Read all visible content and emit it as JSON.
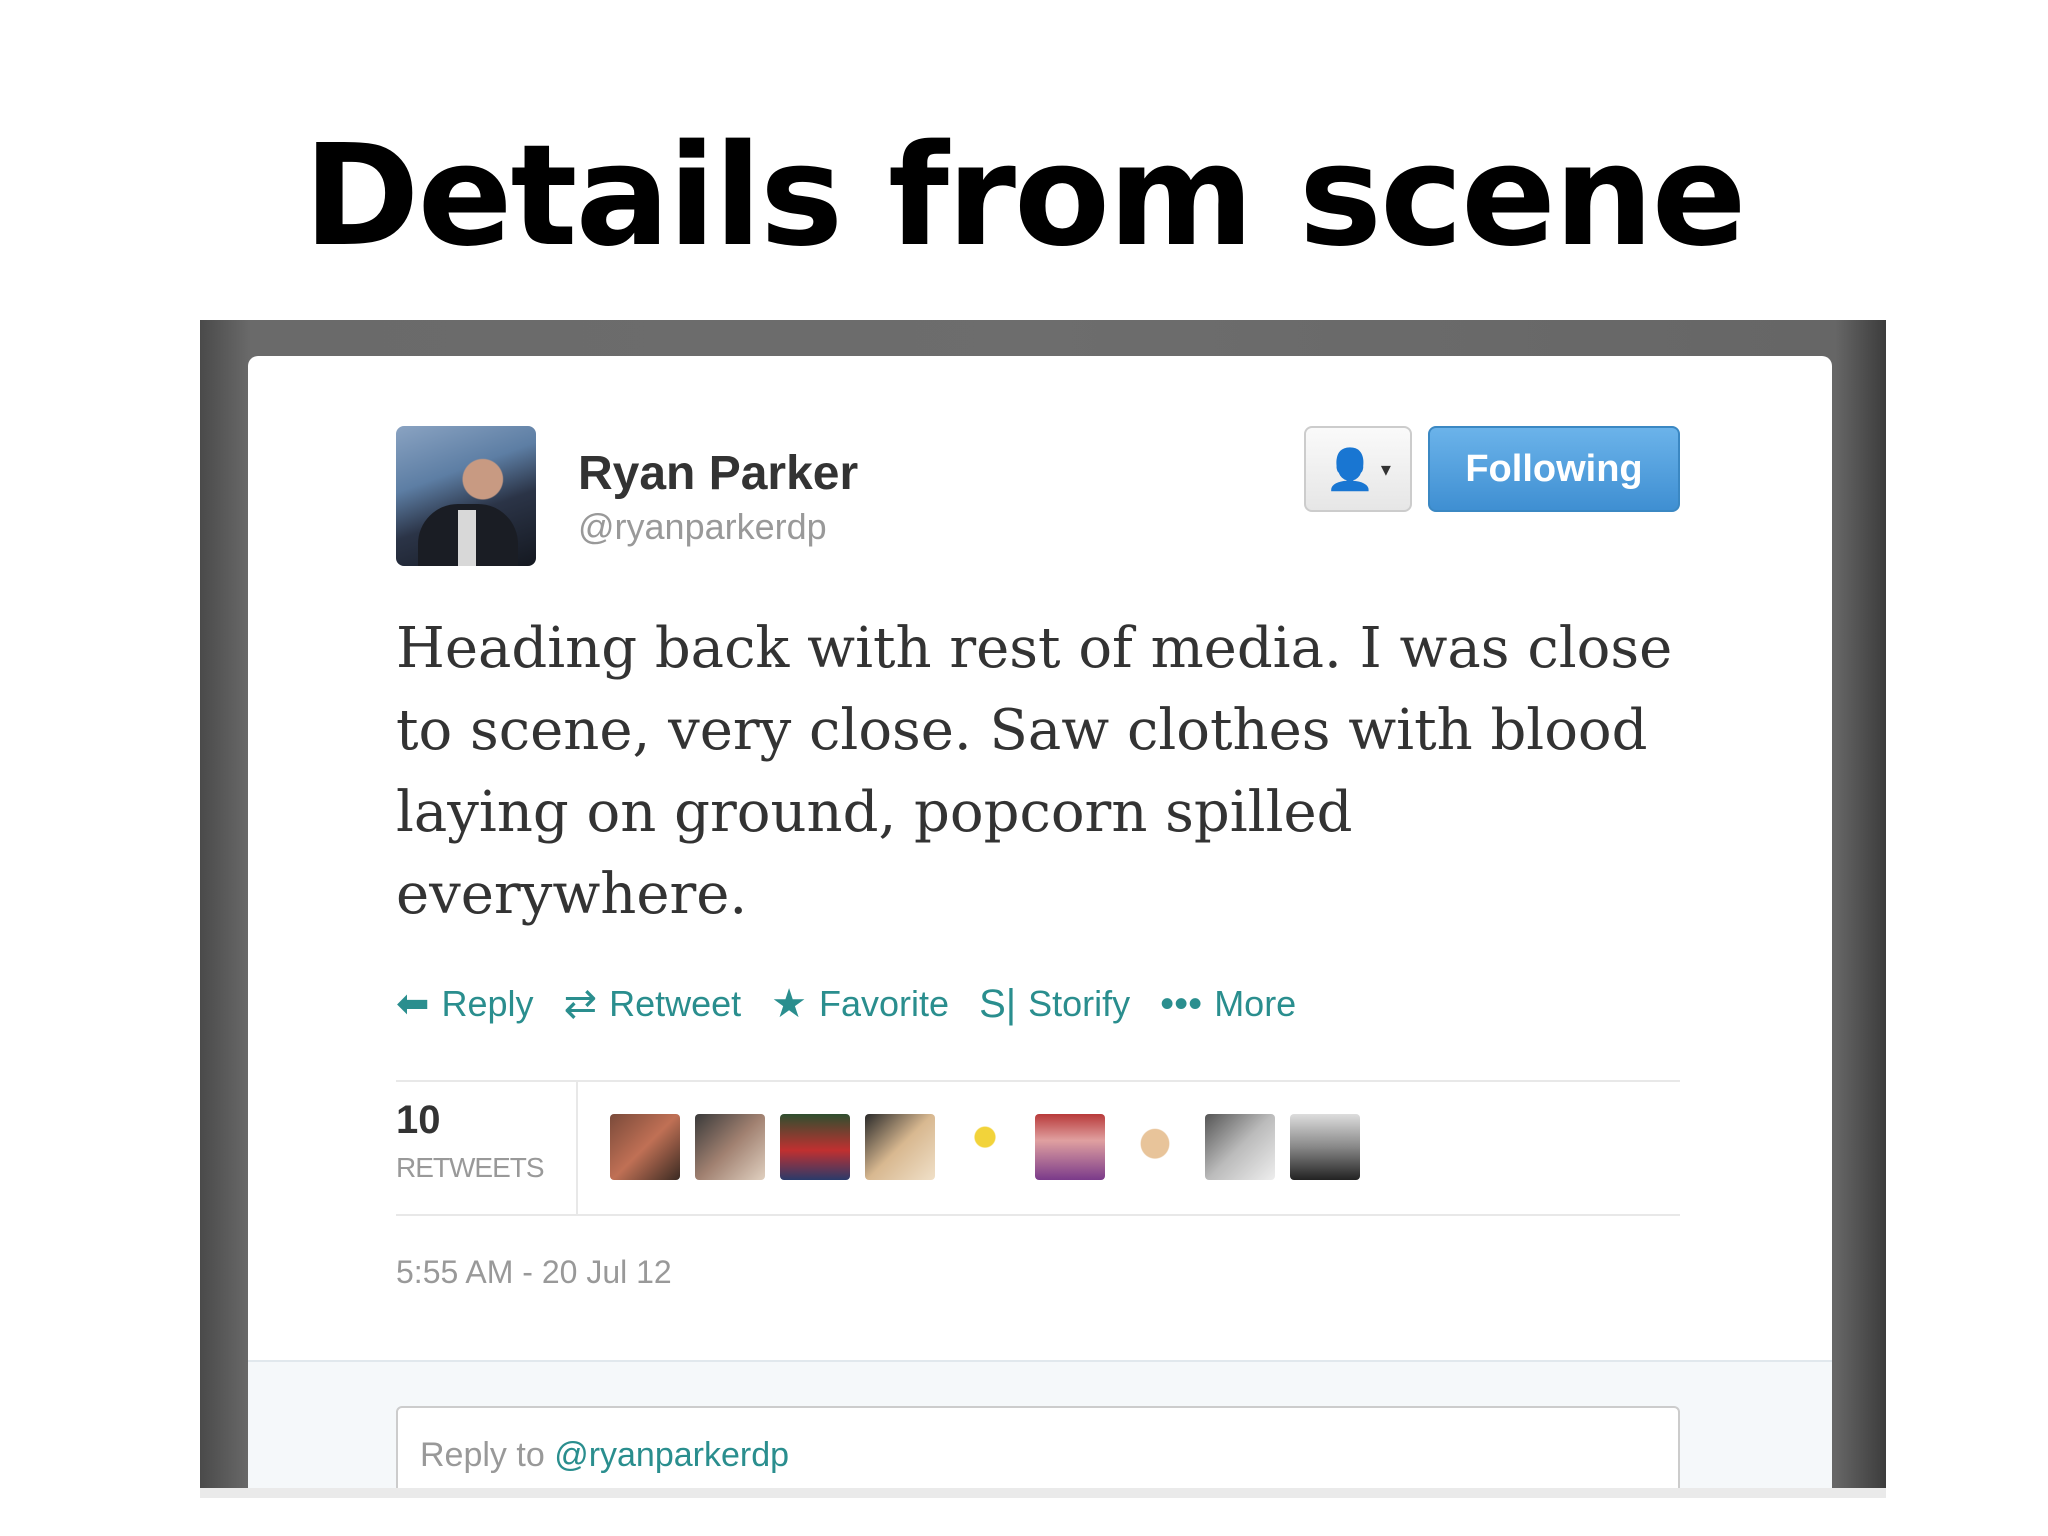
{
  "slide": {
    "title": "Details from scene"
  },
  "tweet": {
    "author": {
      "name": "Ryan Parker",
      "handle": "@ryanparkerdp"
    },
    "follow_button_label": "Following",
    "text": "Heading back with rest of media. I was close to scene, very close. Saw clothes with blood laying on ground, popcorn spilled everywhere.",
    "actions": [
      {
        "label": "Reply",
        "icon": "reply-icon",
        "glyph": "⬅"
      },
      {
        "label": "Retweet",
        "icon": "retweet-icon",
        "glyph": "⇄"
      },
      {
        "label": "Favorite",
        "icon": "star-icon",
        "glyph": "★"
      },
      {
        "label": "Storify",
        "icon": "storify-icon",
        "glyph": "S|"
      },
      {
        "label": "More",
        "icon": "more-icon",
        "glyph": "•••"
      }
    ],
    "retweets": {
      "count": "10",
      "label": "RETWEETS"
    },
    "timestamp": "5:55 AM - 20 Jul 12",
    "reply_box": {
      "prefix": "Reply to ",
      "mention": "@ryanparkerdp"
    }
  },
  "colors": {
    "accent": "#2a8e8e",
    "following_button": "#4a9be0",
    "frame": "#6d6d6d"
  }
}
